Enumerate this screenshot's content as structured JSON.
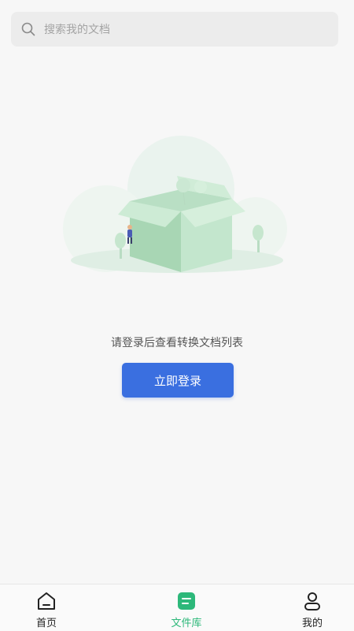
{
  "search": {
    "placeholder": "搜索我的文档",
    "icon": "search-icon"
  },
  "empty_state": {
    "illustration": "empty-box-illustration",
    "message": "请登录后查看转换文档列表",
    "login_button_label": "立即登录"
  },
  "bottom_nav": {
    "items": [
      {
        "label": "首页",
        "icon": "home-icon",
        "active": false
      },
      {
        "label": "文件库",
        "icon": "file-library-icon",
        "active": true
      },
      {
        "label": "我的",
        "icon": "user-icon",
        "active": false
      }
    ]
  },
  "colors": {
    "accent": "#3a6fe0",
    "active_tab": "#2db87a",
    "background": "#f7f7f7"
  }
}
